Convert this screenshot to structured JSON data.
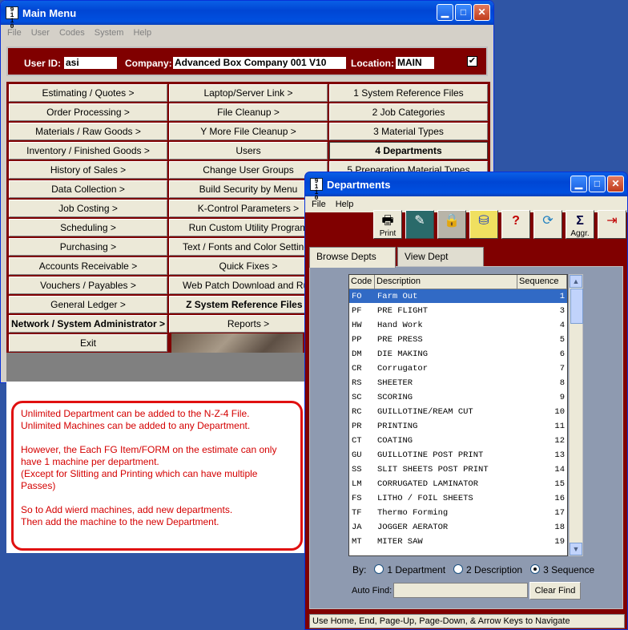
{
  "main_window": {
    "title": "Main Menu",
    "menu": [
      "File",
      "User",
      "Codes",
      "System",
      "Help"
    ],
    "user_id_label": "User ID:",
    "user_id": "asi",
    "company_label": "Company:",
    "company": "Advanced Box Company 001 V10",
    "location_label": "Location:",
    "location": "MAIN",
    "checkbox_mark": "✔",
    "col1": [
      "Estimating / Quotes >",
      "Order Processing >",
      "Materials / Raw Goods >",
      "Inventory / Finished Goods >",
      "History of Sales >",
      "Data Collection >",
      "Job Costing >",
      "Scheduling >",
      "Purchasing >",
      "Accounts Receivable >",
      "Vouchers / Payables >",
      "General Ledger >",
      "Network / System Administrator >",
      "Exit"
    ],
    "col2": [
      "Laptop/Server Link >",
      "File Cleanup >",
      "Y More File Cleanup >",
      "Users",
      "Change User Groups",
      "Build Security by Menu",
      "K-Control Parameters >",
      "Run Custom Utility Program",
      "Text / Fonts and Color Settings",
      "Quick Fixes >",
      "Web Patch Download and Run",
      "Z System Reference Files >",
      "Reports >"
    ],
    "col3": [
      "1 System Reference Files",
      "2 Job Categories",
      "3 Material Types",
      "4 Departments",
      "5 Preparation Material Types"
    ],
    "note": [
      "Unlimited Department can be added to the N-Z-4 File.",
      "Unlimited Machines can be added to any Department.",
      "",
      "However, the Each FG Item/FORM on the estimate can only have 1 machine per department.",
      "(Except for Slitting and Printing which can have multiple Passes)",
      "",
      "So to Add wierd machines, add new departments.",
      "Then add the machine to the new Department."
    ]
  },
  "dept_window": {
    "title": "Departments",
    "menu": [
      "File",
      "Help"
    ],
    "tools": [
      {
        "label": "Print",
        "icon": "printer-icon"
      },
      {
        "label": "",
        "icon": "edit-icon"
      },
      {
        "label": "",
        "icon": "lock-icon"
      },
      {
        "label": "",
        "icon": "database-icon"
      },
      {
        "label": "",
        "icon": "help-icon"
      },
      {
        "label": "",
        "icon": "refresh-icon"
      },
      {
        "label": "Aggr.",
        "icon": "sigma-icon"
      },
      {
        "label": "",
        "icon": "exit-icon"
      }
    ],
    "tabs": [
      "Browse Depts",
      "View Dept"
    ],
    "columns": [
      "Code",
      "Description",
      "Sequence"
    ],
    "rows": [
      [
        "FO",
        "Farm Out",
        "1"
      ],
      [
        "PF",
        "PRE FLIGHT",
        "3"
      ],
      [
        "HW",
        "Hand Work",
        "4"
      ],
      [
        "PP",
        "PRE PRESS",
        "5"
      ],
      [
        "DM",
        "DIE MAKING",
        "6"
      ],
      [
        "CR",
        "Corrugator",
        "7"
      ],
      [
        "RS",
        "SHEETER",
        "8"
      ],
      [
        "SC",
        "SCORING",
        "9"
      ],
      [
        "RC",
        "GUILLOTINE/REAM CUT",
        "10"
      ],
      [
        "PR",
        "PRINTING",
        "11"
      ],
      [
        "CT",
        "COATING",
        "12"
      ],
      [
        "GU",
        "GUILLOTINE POST PRINT",
        "13"
      ],
      [
        "SS",
        "SLIT SHEETS POST PRINT",
        "14"
      ],
      [
        "LM",
        "CORRUGATED LAMINATOR",
        "15"
      ],
      [
        "FS",
        "LITHO / FOIL SHEETS",
        "16"
      ],
      [
        "TF",
        "Thermo Forming",
        "17"
      ],
      [
        "JA",
        "JOGGER AERATOR",
        "18"
      ],
      [
        "MT",
        "MITER SAW",
        "19"
      ]
    ],
    "by_label": "By:",
    "sort_options": [
      "1 Department",
      "2 Description",
      "3 Sequence"
    ],
    "selected_sort": 2,
    "auto_find_label": "Auto Find:",
    "auto_find_value": "",
    "clear_find": "Clear Find",
    "status": "Use Home, End, Page-Up, Page-Down, & Arrow Keys to Navigate"
  }
}
